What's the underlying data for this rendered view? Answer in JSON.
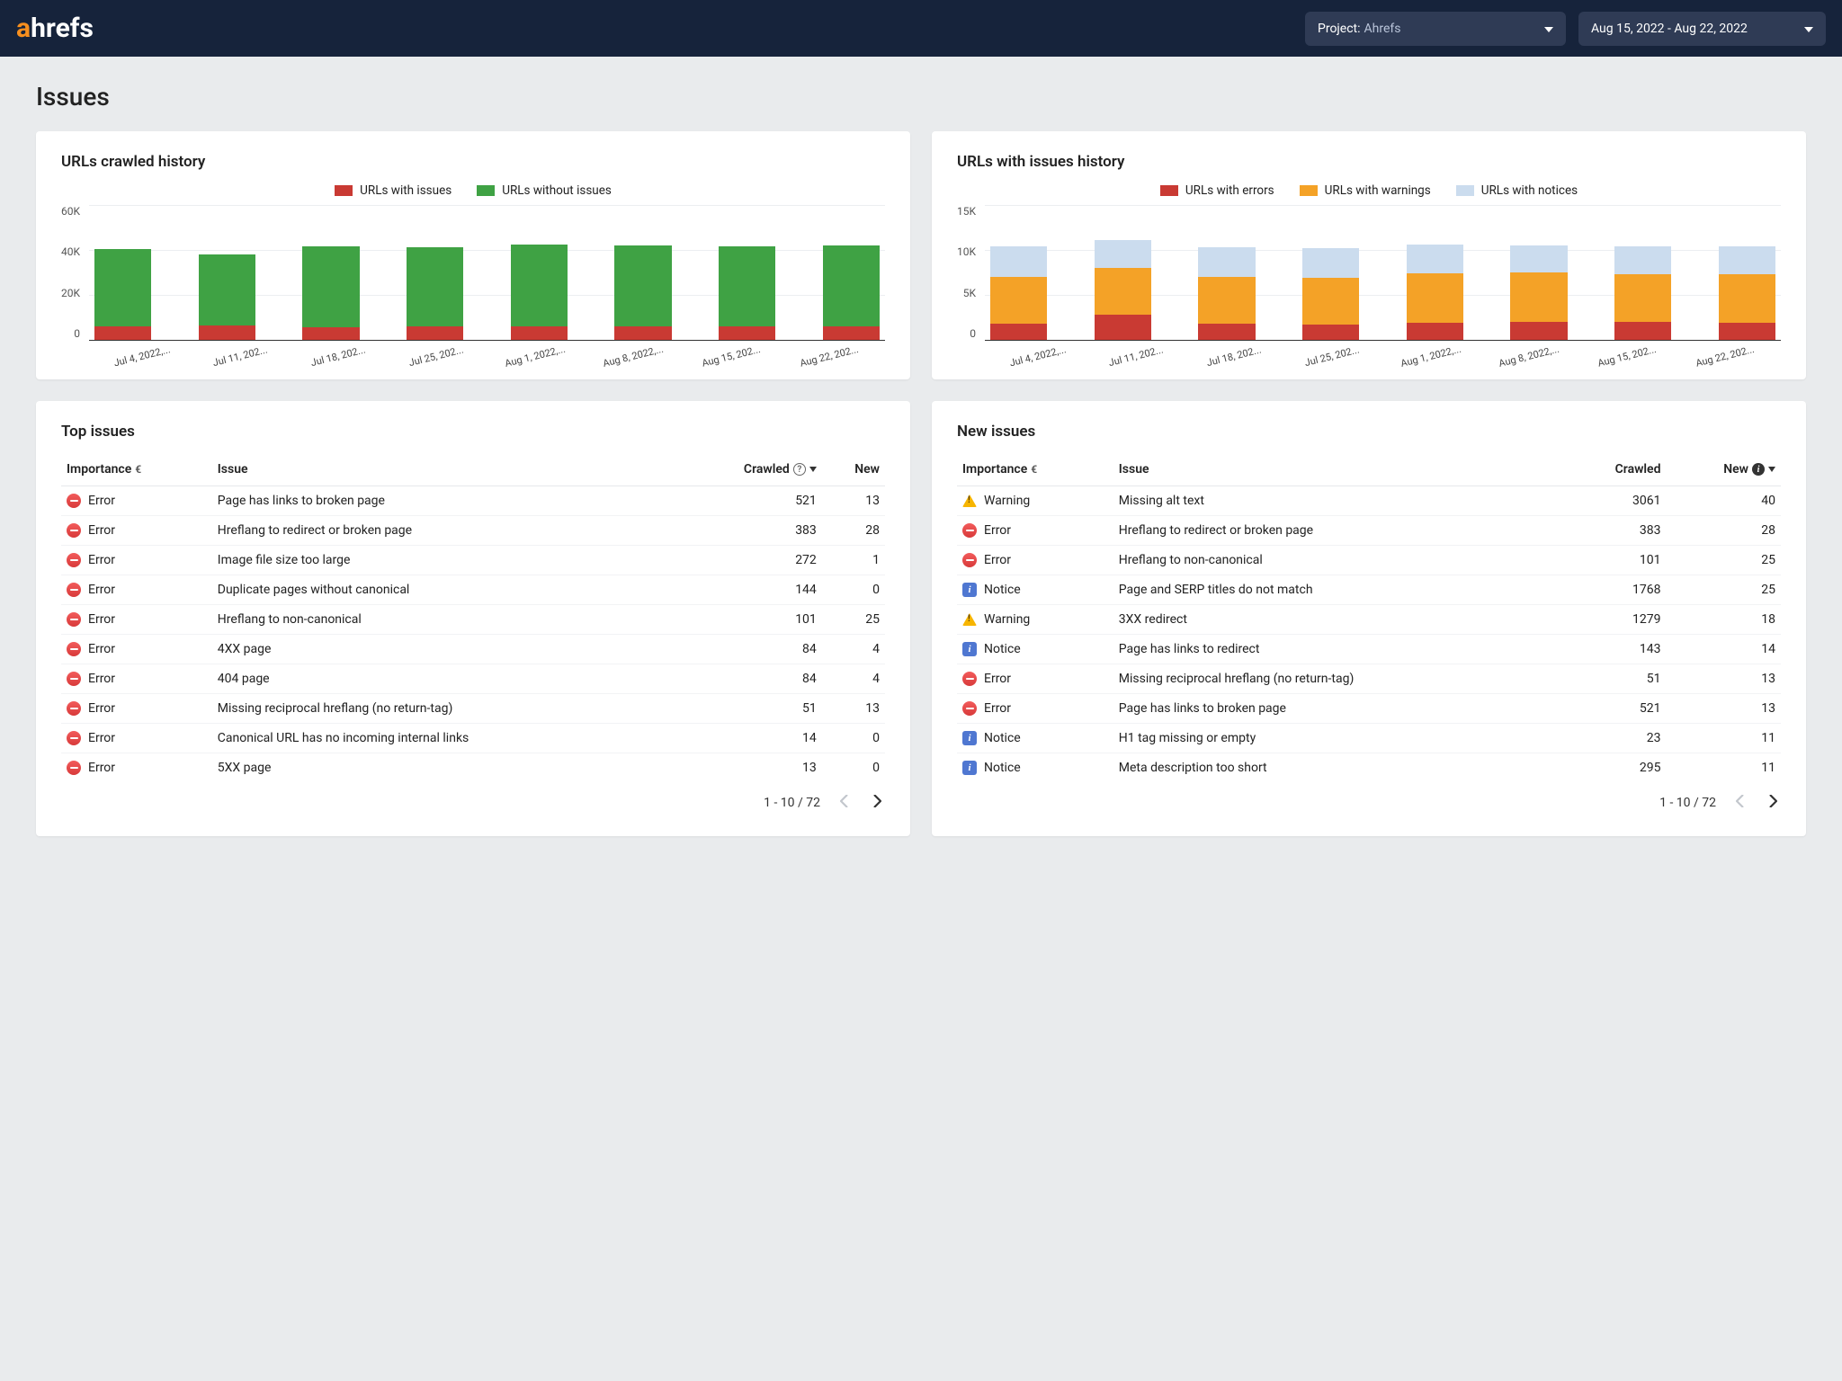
{
  "header": {
    "logo_a": "a",
    "logo_rest": "hrefs",
    "project_label": "Project",
    "project_value": "Ahrefs",
    "date_range": "Aug 15, 2022 - Aug 22, 2022"
  },
  "page_title": "Issues",
  "colors": {
    "with_issues": "#c93a33",
    "without_issues": "#3fa244",
    "errors": "#c93a33",
    "warnings": "#f4a227",
    "notices": "#cbdcee"
  },
  "chart_data": [
    {
      "type": "bar",
      "title": "URLs crawled history",
      "ylabel": "",
      "ylim": [
        0,
        60000
      ],
      "yticks": [
        "60K",
        "40K",
        "20K",
        "0"
      ],
      "categories": [
        "Jul 4, 2022,...",
        "Jul 11, 202...",
        "Jul 18, 202...",
        "Jul 25, 202...",
        "Aug 1, 2022,...",
        "Aug 8, 2022,...",
        "Aug 15, 202...",
        "Aug 22, 202..."
      ],
      "series": [
        {
          "name": "URLs with issues",
          "color_key": "with_issues",
          "values": [
            6000,
            6500,
            5800,
            5900,
            6000,
            6000,
            6200,
            6200
          ]
        },
        {
          "name": "URLs without issues",
          "color_key": "without_issues",
          "values": [
            34500,
            31500,
            35700,
            35400,
            36500,
            36000,
            35500,
            36000
          ]
        }
      ]
    },
    {
      "type": "bar",
      "title": "URLs with issues history",
      "ylabel": "",
      "ylim": [
        0,
        15000
      ],
      "yticks": [
        "15K",
        "10K",
        "5K",
        "0"
      ],
      "categories": [
        "Jul 4, 2022,...",
        "Jul 11, 202...",
        "Jul 18, 202...",
        "Jul 25, 202...",
        "Aug 1, 2022,...",
        "Aug 8, 2022,...",
        "Aug 15, 202...",
        "Aug 22, 202..."
      ],
      "series": [
        {
          "name": "URLs with errors",
          "color_key": "errors",
          "values": [
            1800,
            2800,
            1800,
            1700,
            1900,
            2000,
            2000,
            1900
          ]
        },
        {
          "name": "URLs with warnings",
          "color_key": "warnings",
          "values": [
            5200,
            5200,
            5200,
            5200,
            5500,
            5500,
            5300,
            5400
          ]
        },
        {
          "name": "URLs with notices",
          "color_key": "notices",
          "values": [
            3400,
            3100,
            3300,
            3300,
            3200,
            3000,
            3100,
            3100
          ]
        }
      ]
    }
  ],
  "tables": {
    "top": {
      "title": "Top issues",
      "columns": {
        "importance": "Importance",
        "issue": "Issue",
        "crawled": "Crawled",
        "new": "New"
      },
      "rows": [
        {
          "sev": "error",
          "sev_label": "Error",
          "issue": "Page has links to broken page",
          "crawled": 521,
          "new": 13
        },
        {
          "sev": "error",
          "sev_label": "Error",
          "issue": "Hreflang to redirect or broken page",
          "crawled": 383,
          "new": 28
        },
        {
          "sev": "error",
          "sev_label": "Error",
          "issue": "Image file size too large",
          "crawled": 272,
          "new": 1
        },
        {
          "sev": "error",
          "sev_label": "Error",
          "issue": "Duplicate pages without canonical",
          "crawled": 144,
          "new": 0
        },
        {
          "sev": "error",
          "sev_label": "Error",
          "issue": "Hreflang to non-canonical",
          "crawled": 101,
          "new": 25
        },
        {
          "sev": "error",
          "sev_label": "Error",
          "issue": "4XX page",
          "crawled": 84,
          "new": 4
        },
        {
          "sev": "error",
          "sev_label": "Error",
          "issue": "404 page",
          "crawled": 84,
          "new": 4
        },
        {
          "sev": "error",
          "sev_label": "Error",
          "issue": "Missing reciprocal hreflang (no return-tag)",
          "crawled": 51,
          "new": 13
        },
        {
          "sev": "error",
          "sev_label": "Error",
          "issue": "Canonical URL has no incoming internal links",
          "crawled": 14,
          "new": 0
        },
        {
          "sev": "error",
          "sev_label": "Error",
          "issue": "5XX page",
          "crawled": 13,
          "new": 0
        }
      ],
      "pager": "1 - 10 / 72"
    },
    "new": {
      "title": "New issues",
      "columns": {
        "importance": "Importance",
        "issue": "Issue",
        "crawled": "Crawled",
        "new": "New"
      },
      "rows": [
        {
          "sev": "warning",
          "sev_label": "Warning",
          "issue": "Missing alt text",
          "crawled": 3061,
          "new": 40
        },
        {
          "sev": "error",
          "sev_label": "Error",
          "issue": "Hreflang to redirect or broken page",
          "crawled": 383,
          "new": 28
        },
        {
          "sev": "error",
          "sev_label": "Error",
          "issue": "Hreflang to non-canonical",
          "crawled": 101,
          "new": 25
        },
        {
          "sev": "notice",
          "sev_label": "Notice",
          "issue": "Page and SERP titles do not match",
          "crawled": 1768,
          "new": 25
        },
        {
          "sev": "warning",
          "sev_label": "Warning",
          "issue": "3XX redirect",
          "crawled": 1279,
          "new": 18
        },
        {
          "sev": "notice",
          "sev_label": "Notice",
          "issue": "Page has links to redirect",
          "crawled": 143,
          "new": 14
        },
        {
          "sev": "error",
          "sev_label": "Error",
          "issue": "Missing reciprocal hreflang (no return-tag)",
          "crawled": 51,
          "new": 13
        },
        {
          "sev": "error",
          "sev_label": "Error",
          "issue": "Page has links to broken page",
          "crawled": 521,
          "new": 13
        },
        {
          "sev": "notice",
          "sev_label": "Notice",
          "issue": "H1 tag missing or empty",
          "crawled": 23,
          "new": 11
        },
        {
          "sev": "notice",
          "sev_label": "Notice",
          "issue": "Meta description too short",
          "crawled": 295,
          "new": 11
        }
      ],
      "pager": "1 - 10 / 72"
    }
  }
}
